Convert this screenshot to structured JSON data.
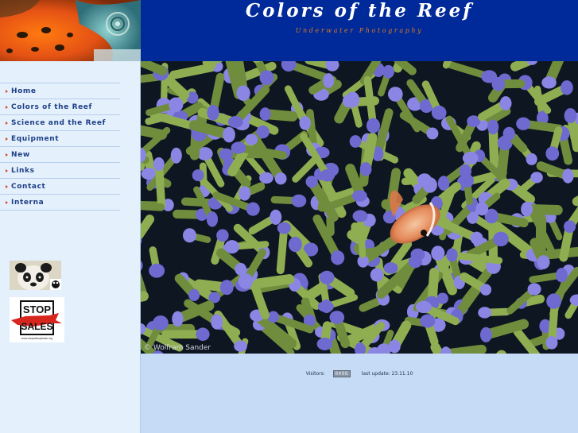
{
  "header": {
    "title": "Colors of the Reef",
    "subtitle": "Underwater Photography",
    "bar_color": "#002a99",
    "subtitle_color": "#e07a1e"
  },
  "sidebar": {
    "items": [
      {
        "label": "Home",
        "icon": "arrow-right-icon"
      },
      {
        "label": "Colors of the Reef",
        "icon": "arrow-right-icon"
      },
      {
        "label": "Science and the Reef",
        "icon": "arrow-right-icon"
      },
      {
        "label": "Equipment",
        "icon": "arrow-right-icon"
      },
      {
        "label": "New",
        "icon": "arrow-right-icon"
      },
      {
        "label": "Links",
        "icon": "arrow-right-icon"
      },
      {
        "label": "Contact",
        "icon": "arrow-right-icon"
      },
      {
        "label": "Interna",
        "icon": "arrow-right-icon"
      }
    ],
    "badges": {
      "wwf": {
        "logo_text": "WWF"
      },
      "stop_sales": {
        "line1": "STOP",
        "line2": "SALES",
        "small": "www.stopsalesplease.org"
      }
    }
  },
  "main": {
    "photo_credit": "© Wolfram Sander"
  },
  "footer": {
    "visitors_label": "Visitors:",
    "counter_value": "0498",
    "last_update_label": "last update: 23.11.10"
  }
}
